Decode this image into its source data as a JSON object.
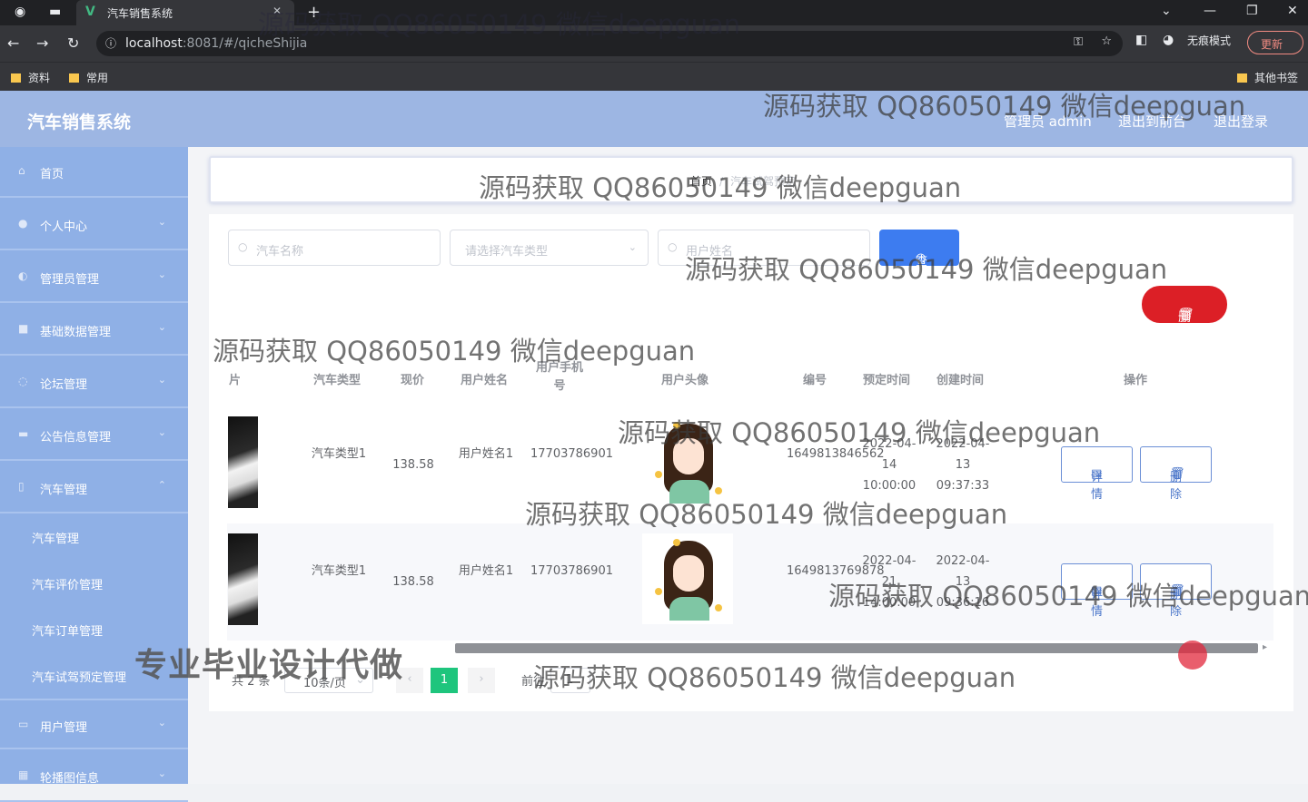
{
  "browser": {
    "tab_title": "汽车销售系统",
    "url_host": "localhost",
    "url_rest": ":8081/#/qicheShijia",
    "incognito_label": "无痕模式",
    "update_label": "更新",
    "bookmarks": [
      "资料",
      "常用"
    ],
    "other_bookmarks": "其他书签"
  },
  "app": {
    "title": "汽车销售系统",
    "header_links": [
      "管理员 admin",
      "退出到前台",
      "退出登录"
    ]
  },
  "sidebar": {
    "items": [
      {
        "label": "首页",
        "icon": "home-icon",
        "arrow": false
      },
      {
        "label": "个人中心",
        "icon": "user-icon",
        "arrow": true
      },
      {
        "label": "管理员管理",
        "icon": "admin-icon",
        "arrow": true
      },
      {
        "label": "基础数据管理",
        "icon": "data-icon",
        "arrow": true
      },
      {
        "label": "论坛管理",
        "icon": "forum-icon",
        "arrow": true
      },
      {
        "label": "公告信息管理",
        "icon": "notice-icon",
        "arrow": true
      },
      {
        "label": "汽车管理",
        "icon": "car-icon",
        "arrow": true
      }
    ],
    "sub_items": [
      "汽车管理",
      "汽车评价管理",
      "汽车订单管理",
      "汽车试驾预定管理"
    ],
    "items_after": [
      {
        "label": "用户管理",
        "icon": "users-icon",
        "arrow": true
      },
      {
        "label": "轮播图信息",
        "icon": "image-icon",
        "arrow": true
      }
    ]
  },
  "breadcrumb": {
    "home": "首页",
    "current": "汽车试驾预定"
  },
  "search": {
    "car_name_placeholder": "汽车名称",
    "car_type_placeholder": "请选择汽车类型",
    "user_name_placeholder": "用户姓名",
    "query_label": "查询",
    "delete_label": "删除"
  },
  "table": {
    "headers": [
      "片",
      "汽车类型",
      "现价",
      "用户姓名",
      "用户手机号",
      "用户头像",
      "编号",
      "预定时间",
      "创建时间",
      "操作"
    ],
    "rows": [
      {
        "car_type": "汽车类型1",
        "price": "138.58",
        "user_name": "用户姓名1",
        "phone": "17703786901",
        "number": "1649813846562",
        "reserve_time": "2022-04-14 10:00:00",
        "create_time": "2022-04-13 09:37:33"
      },
      {
        "car_type": "汽车类型1",
        "price": "138.58",
        "user_name": "用户姓名1",
        "phone": "17703786901",
        "number": "1649813769878",
        "reserve_time": "2022-04-21 14:00:00",
        "create_time": "2022-04-13 09:36:16"
      }
    ],
    "detail_label": "详情",
    "delete_label": "删除"
  },
  "pagination": {
    "total": "共 2 条",
    "page_size": "10条/页",
    "current_page": "1",
    "goto_label": "前往",
    "goto_value": "1"
  },
  "overlay": {
    "watermark": "源码获取 QQ86050149 微信deepguan",
    "badge": "专业毕业设计代做"
  },
  "colors": {
    "header": "#9db6e3",
    "sidebar": "#8fb0e6",
    "query": "#3d7cf0",
    "danger": "#dc1f26",
    "page_active": "#1ec57d"
  }
}
